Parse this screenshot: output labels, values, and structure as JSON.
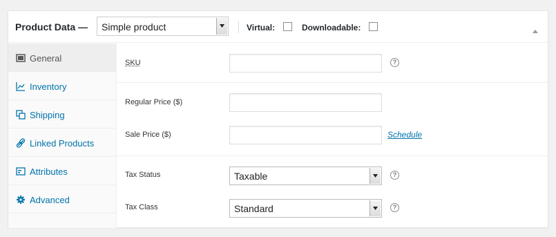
{
  "header": {
    "title": "Product Data —",
    "product_type": "Simple product",
    "virtual_label": "Virtual:",
    "virtual_checked": false,
    "downloadable_label": "Downloadable:",
    "downloadable_checked": false
  },
  "sidebar": {
    "items": [
      {
        "label": "General",
        "icon": "general-icon",
        "active": true
      },
      {
        "label": "Inventory",
        "icon": "inventory-icon",
        "active": false
      },
      {
        "label": "Shipping",
        "icon": "shipping-icon",
        "active": false
      },
      {
        "label": "Linked Products",
        "icon": "link-icon",
        "active": false
      },
      {
        "label": "Attributes",
        "icon": "attributes-icon",
        "active": false
      },
      {
        "label": "Advanced",
        "icon": "gear-icon",
        "active": false
      }
    ]
  },
  "general": {
    "sku": {
      "label": "SKU",
      "value": ""
    },
    "regular_price": {
      "label": "Regular Price ($)",
      "value": ""
    },
    "sale_price": {
      "label": "Sale Price ($)",
      "value": "",
      "schedule_link": "Schedule"
    },
    "tax_status": {
      "label": "Tax Status",
      "value": "Taxable"
    },
    "tax_class": {
      "label": "Tax Class",
      "value": "Standard"
    }
  },
  "help_glyph": "?",
  "colors": {
    "link": "#0073aa",
    "active_tab_bg": "#eeeeee",
    "panel_border": "#e5e5e5"
  }
}
